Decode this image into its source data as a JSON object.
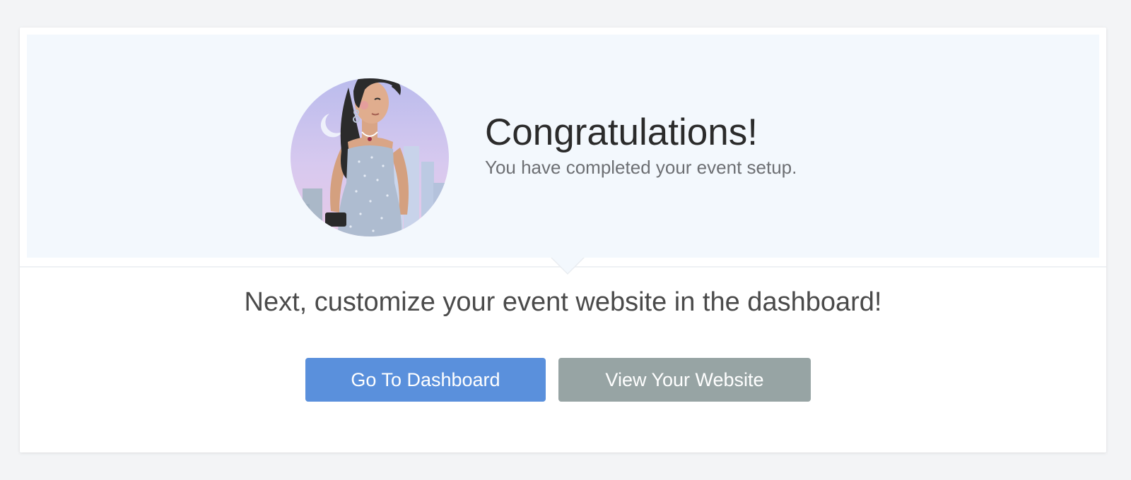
{
  "hero": {
    "title": "Congratulations!",
    "subtitle": "You have completed your event setup."
  },
  "main": {
    "instruction": "Next, customize your event website in the dashboard!",
    "buttons": {
      "dashboard_label": "Go To Dashboard",
      "website_label": "View Your Website"
    }
  },
  "colors": {
    "page_background": "#f3f4f6",
    "hero_background": "#f3f8fd",
    "primary_button": "#5a90dc",
    "secondary_button": "#97a4a4"
  },
  "icons": {
    "avatar": "woman-in-gown-illustration"
  }
}
